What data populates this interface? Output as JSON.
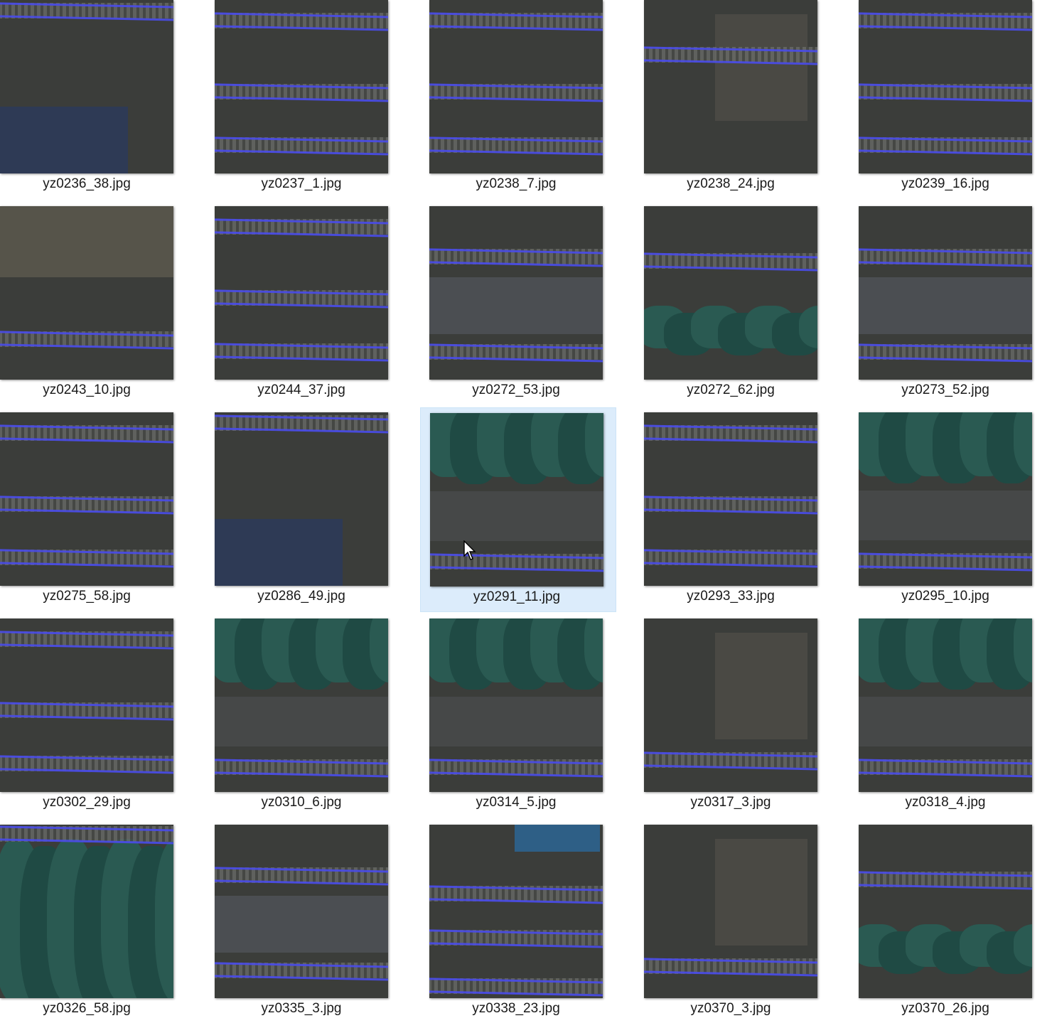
{
  "window": {
    "view": "Large icons",
    "selected_file": "yz0291_11.jpg"
  },
  "files": [
    {
      "name": "yz0236_38.jpg",
      "scene": "tracks-roof"
    },
    {
      "name": "yz0237_1.jpg",
      "scene": "tracks"
    },
    {
      "name": "yz0238_7.jpg",
      "scene": "tracks"
    },
    {
      "name": "yz0238_24.jpg",
      "scene": "tracks-structure"
    },
    {
      "name": "yz0239_16.jpg",
      "scene": "tracks"
    },
    {
      "name": "yz0243_10.jpg",
      "scene": "building-tracks"
    },
    {
      "name": "yz0244_37.jpg",
      "scene": "tracks"
    },
    {
      "name": "yz0272_53.jpg",
      "scene": "platform-tracks"
    },
    {
      "name": "yz0272_62.jpg",
      "scene": "tracks-vegetation"
    },
    {
      "name": "yz0273_52.jpg",
      "scene": "platform-tracks"
    },
    {
      "name": "yz0275_58.jpg",
      "scene": "tracks"
    },
    {
      "name": "yz0286_49.jpg",
      "scene": "tracks-roof"
    },
    {
      "name": "yz0291_11.jpg",
      "scene": "trees-platform"
    },
    {
      "name": "yz0293_33.jpg",
      "scene": "tracks"
    },
    {
      "name": "yz0295_10.jpg",
      "scene": "trees-platform"
    },
    {
      "name": "yz0302_29.jpg",
      "scene": "tracks"
    },
    {
      "name": "yz0310_6.jpg",
      "scene": "trees-platform"
    },
    {
      "name": "yz0314_5.jpg",
      "scene": "trees-platform"
    },
    {
      "name": "yz0317_3.jpg",
      "scene": "structure-tracks"
    },
    {
      "name": "yz0318_4.jpg",
      "scene": "trees-platform"
    },
    {
      "name": "yz0326_58.jpg",
      "scene": "trees"
    },
    {
      "name": "yz0335_3.jpg",
      "scene": "platform-tracks"
    },
    {
      "name": "yz0338_23.jpg",
      "scene": "tracks-containers"
    },
    {
      "name": "yz0370_3.jpg",
      "scene": "structure-tracks"
    },
    {
      "name": "yz0370_26.jpg",
      "scene": "tracks-vegetation"
    }
  ],
  "colors": {
    "selection_bg": "#dcecfb",
    "rail_line": "#4a4ce8",
    "ground": "#3b3d3a",
    "tree": "#1f4a44"
  }
}
